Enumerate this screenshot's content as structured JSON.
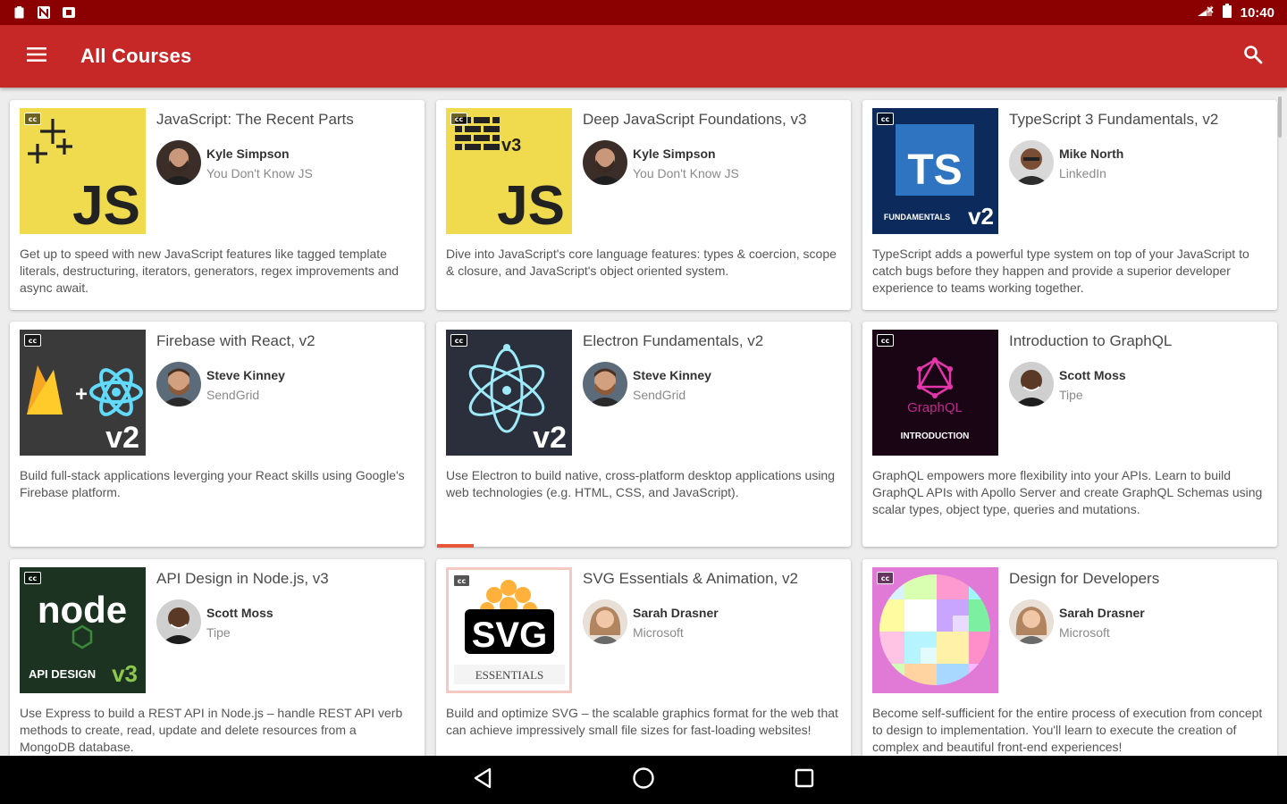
{
  "status_bar": {
    "time": "10:40",
    "left_icons": [
      "clipboard-icon",
      "n-notification-icon",
      "media-icon"
    ],
    "right_icons": [
      "signal-icon",
      "battery-icon"
    ]
  },
  "app_bar": {
    "title": "All Courses",
    "menu_icon": "hamburger-menu-icon",
    "search_icon": "search-icon",
    "background": "#c62828"
  },
  "courses": [
    {
      "title": "JavaScript: The Recent Parts",
      "instructor": "Kyle Simpson",
      "company": "You Don't Know JS",
      "description": "Get up to speed with new JavaScript features like tagged template literals, destructuring, iterators, generators, regex improvements and async await.",
      "thumb": {
        "text": "JS",
        "badge": "",
        "bg": "#f0db4f"
      }
    },
    {
      "title": "Deep JavaScript Foundations, v3",
      "instructor": "Kyle Simpson",
      "company": "You Don't Know JS",
      "description": "Dive into JavaScript's core language features: types & coercion, scope & closure, and JavaScript's object oriented system.",
      "thumb": {
        "text": "JS",
        "badge": "v3",
        "bg": "#f0db4f"
      }
    },
    {
      "title": "TypeScript 3 Fundamentals, v2",
      "instructor": "Mike North",
      "company": "LinkedIn",
      "description": "TypeScript adds a powerful type system on top of your JavaScript to catch bugs before they happen and provide a superior developer experience to teams working together.",
      "thumb": {
        "text": "TS",
        "caption": "FUNDAMENTALS",
        "badge": "v2",
        "bg": "#0c2b5c"
      }
    },
    {
      "title": "Firebase with React, v2",
      "instructor": "Steve Kinney",
      "company": "SendGrid",
      "description": "Build full-stack applications leverging your React skills using Google's Firebase platform.",
      "thumb": {
        "badge": "v2",
        "bg": "#3a3a3a"
      }
    },
    {
      "title": "Electron Fundamentals, v2",
      "instructor": "Steve Kinney",
      "company": "SendGrid",
      "description": "Use Electron to build native, cross-platform desktop applications using web technologies (e.g. HTML, CSS, and JavaScript).",
      "thumb": {
        "badge": "v2",
        "bg": "#2b2e3b"
      }
    },
    {
      "title": "Introduction to GraphQL",
      "instructor": "Scott Moss",
      "company": "Tipe",
      "description": "GraphQL empowers more flexibility into your APIs. Learn to build GraphQL APIs with Apollo Server and create GraphQL Schemas using scalar types, object type, queries and mutations.",
      "thumb": {
        "text": "GraphQL",
        "caption": "INTRODUCTION",
        "bg": "#1a0514"
      }
    },
    {
      "title": "API Design in Node.js, v3",
      "instructor": "Scott Moss",
      "company": "Tipe",
      "description": "Use Express to build a REST API in Node.js – handle REST API verb methods to create, read, update and delete resources from a MongoDB database.",
      "thumb": {
        "text": "node",
        "caption": "API DESIGN",
        "badge": "v3",
        "bg": "#1c3322"
      }
    },
    {
      "title": "SVG Essentials & Animation, v2",
      "instructor": "Sarah Drasner",
      "company": "Microsoft",
      "description": "Build and optimize SVG – the scalable graphics format for the web that can achieve impressively small file sizes for fast-loading websites!",
      "thumb": {
        "text": "SVG",
        "caption": "ESSENTIALS",
        "bg": "#ffffff"
      }
    },
    {
      "title": "Design for Developers",
      "instructor": "Sarah Drasner",
      "company": "Microsoft",
      "description": "Become self-sufficient for the entire process of execution from concept to design to implementation. You'll learn to execute the creation of complex and beautiful front-end experiences!",
      "thumb": {
        "bg": "#f7a6d6"
      }
    }
  ],
  "cc_label": "cc",
  "nav_bar": {
    "back_icon": "back-triangle-icon",
    "home_icon": "home-circle-icon",
    "recents_icon": "recents-square-icon"
  }
}
